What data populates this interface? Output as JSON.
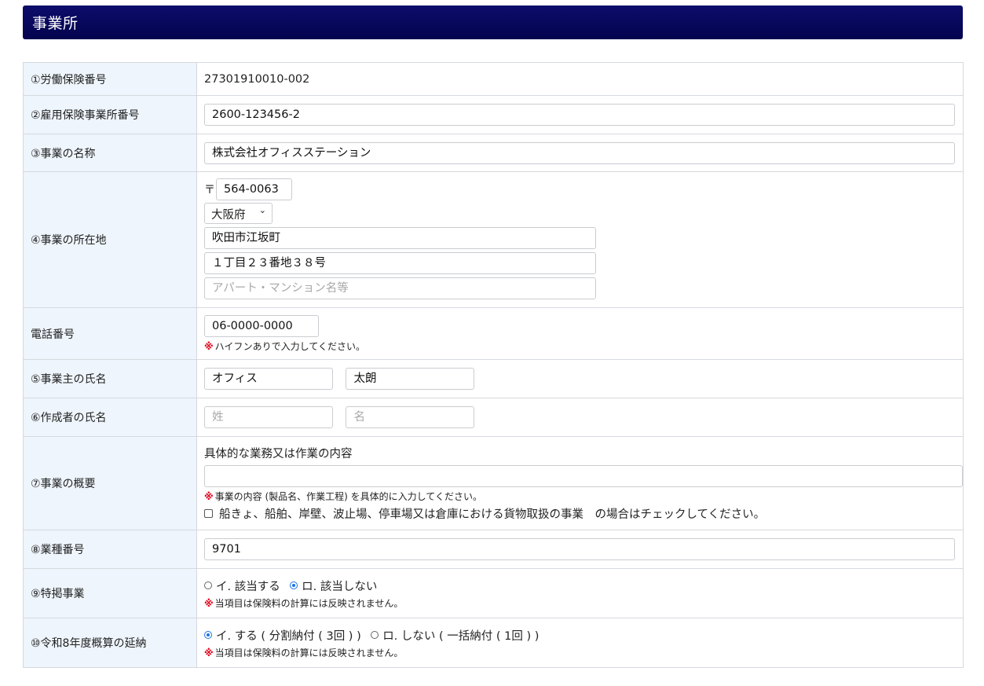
{
  "header": {
    "title": "事業所"
  },
  "rows": {
    "labor_insurance_no": {
      "label": "①労働保険番号",
      "value": "27301910010-002"
    },
    "employment_office_no": {
      "label": "②雇用保険事業所番号",
      "value": "2600-123456-2"
    },
    "business_name": {
      "label": "③事業の名称",
      "value": "株式会社オフィスステーション"
    },
    "address": {
      "label": "④事業の所在地",
      "postal_mark": "〒",
      "postal_code": "564-0063",
      "prefecture": "大阪府",
      "city": "吹田市江坂町",
      "street": "１丁目２３番地３８号",
      "building_placeholder": "アパート・マンション名等"
    },
    "phone": {
      "label": "電話番号",
      "value": "06-0000-0000",
      "note": "ハイフンありで入力してください。"
    },
    "owner_name": {
      "label": "⑤事業主の氏名",
      "last": "オフィス",
      "first": "太朗"
    },
    "creator_name": {
      "label": "⑥作成者の氏名",
      "last_placeholder": "姓",
      "first_placeholder": "名"
    },
    "summary": {
      "label": "⑦事業の概要",
      "heading": "具体的な業務又は作業の内容",
      "value": "",
      "note": "事業の内容 (製品名、作業工程) を具体的に入力してください。",
      "checkbox_label": "船きょ、船舶、岸壁、波止場、停車場又は倉庫における貨物取扱の事業　の場合はチェックしてください。",
      "checkbox_checked": false
    },
    "industry_code": {
      "label": "⑧業種番号",
      "value": "9701"
    },
    "special_business": {
      "label": "⑨特掲事業",
      "option_a": "イ. 該当する",
      "option_b": "ロ. 該当しない",
      "selected": "b",
      "note": "当項目は保険料の計算には反映されません。"
    },
    "deferral": {
      "label": "⑩令和8年度概算の延納",
      "option_a": "イ. する ( 分割納付 ( 3回 ) )",
      "option_b": "ロ. しない ( 一括納付 ( 1回 ) )",
      "selected": "a",
      "note": "当項目は保険料の計算には反映されません。"
    }
  },
  "note_mark": "※"
}
